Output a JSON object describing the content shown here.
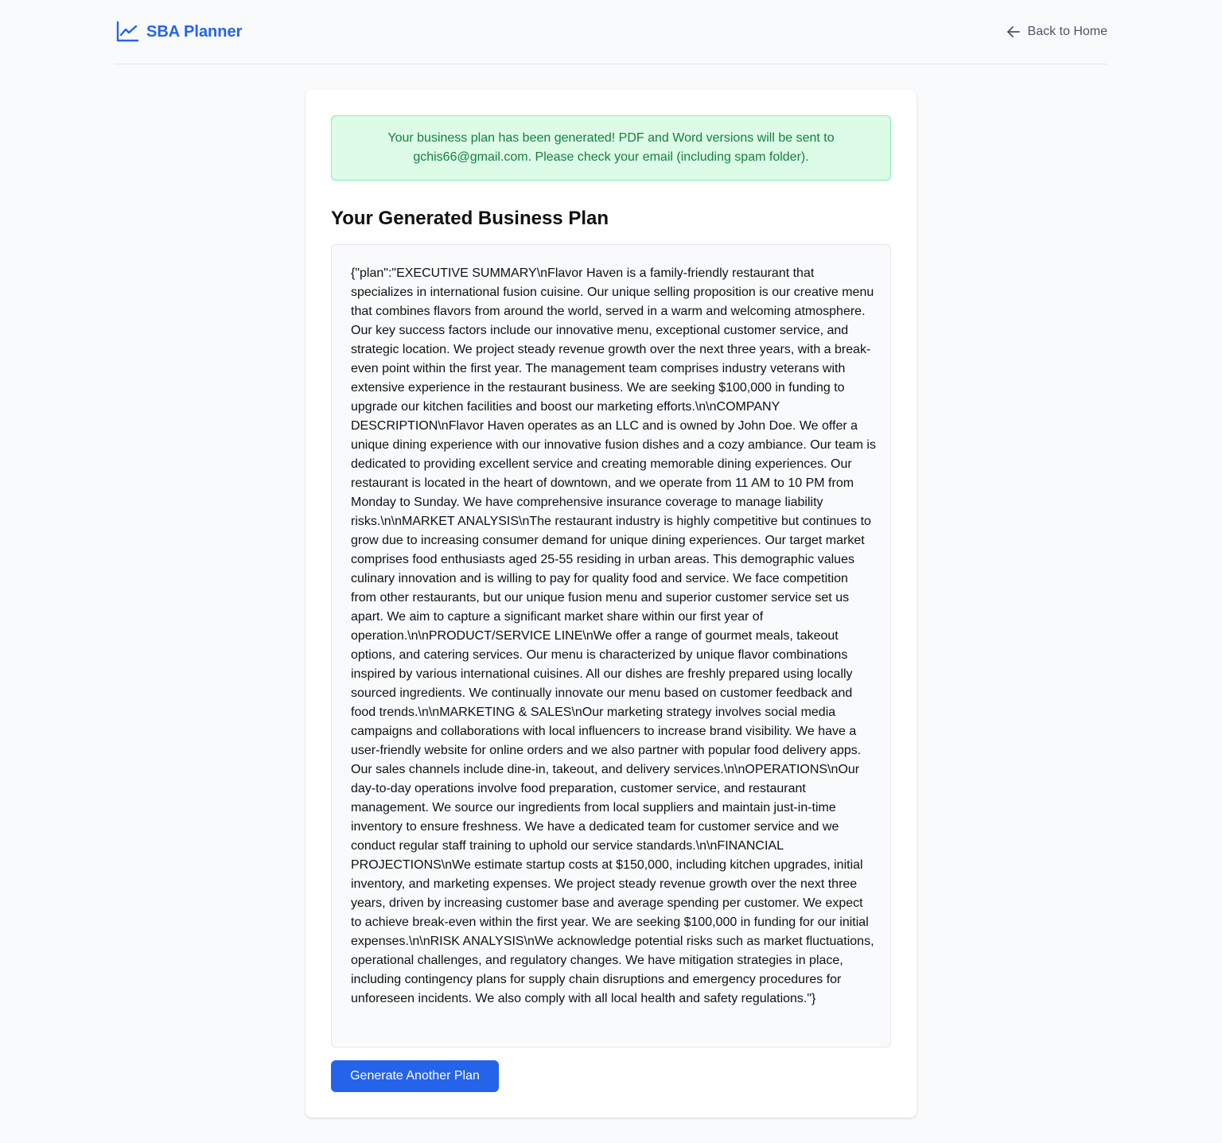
{
  "header": {
    "brand_name": "SBA Planner",
    "brand_icon": "trending-up-icon",
    "back_link_label": "Back to Home",
    "back_icon": "arrow-left-icon"
  },
  "alert": {
    "message": "Your business plan has been generated! PDF and Word versions will be sent to gchis66@gmail.com. Please check your email (including spam folder)."
  },
  "plan": {
    "title": "Your Generated Business Plan",
    "content": "{\"plan\":\"EXECUTIVE SUMMARY\\nFlavor Haven is a family-friendly restaurant that specializes in international fusion cuisine. Our unique selling proposition is our creative menu that combines flavors from around the world, served in a warm and welcoming atmosphere. Our key success factors include our innovative menu, exceptional customer service, and strategic location. We project steady revenue growth over the next three years, with a break-even point within the first year. The management team comprises industry veterans with extensive experience in the restaurant business. We are seeking $100,000 in funding to upgrade our kitchen facilities and boost our marketing efforts.\\n\\nCOMPANY DESCRIPTION\\nFlavor Haven operates as an LLC and is owned by John Doe. We offer a unique dining experience with our innovative fusion dishes and a cozy ambiance. Our team is dedicated to providing excellent service and creating memorable dining experiences. Our restaurant is located in the heart of downtown, and we operate from 11 AM to 10 PM from Monday to Sunday. We have comprehensive insurance coverage to manage liability risks.\\n\\nMARKET ANALYSIS\\nThe restaurant industry is highly competitive but continues to grow due to increasing consumer demand for unique dining experiences. Our target market comprises food enthusiasts aged 25-55 residing in urban areas. This demographic values culinary innovation and is willing to pay for quality food and service. We face competition from other restaurants, but our unique fusion menu and superior customer service set us apart. We aim to capture a significant market share within our first year of operation.\\n\\nPRODUCT/SERVICE LINE\\nWe offer a range of gourmet meals, takeout options, and catering services. Our menu is characterized by unique flavor combinations inspired by various international cuisines. All our dishes are freshly prepared using locally sourced ingredients. We continually innovate our menu based on customer feedback and food trends.\\n\\nMARKETING & SALES\\nOur marketing strategy involves social media campaigns and collaborations with local influencers to increase brand visibility. We have a user-friendly website for online orders and we also partner with popular food delivery apps. Our sales channels include dine-in, takeout, and delivery services.\\n\\nOPERATIONS\\nOur day-to-day operations involve food preparation, customer service, and restaurant management. We source our ingredients from local suppliers and maintain just-in-time inventory to ensure freshness. We have a dedicated team for customer service and we conduct regular staff training to uphold our service standards.\\n\\nFINANCIAL PROJECTIONS\\nWe estimate startup costs at $150,000, including kitchen upgrades, initial inventory, and marketing expenses. We project steady revenue growth over the next three years, driven by increasing customer base and average spending per customer. We expect to achieve break-even within the first year. We are seeking $100,000 in funding for our initial expenses.\\n\\nRISK ANALYSIS\\nWe acknowledge potential risks such as market fluctuations, operational challenges, and regulatory changes. We have mitigation strategies in place, including contingency plans for supply chain disruptions and emergency procedures for unforeseen incidents. We also comply with all local health and safety regulations.\"}"
  },
  "actions": {
    "generate_another_label": "Generate Another Plan"
  },
  "colors": {
    "accent": "#2563eb",
    "success_bg": "#dcfce7",
    "success_border": "#86efac",
    "success_text": "#15803d",
    "page_bg": "#f9fafb"
  }
}
